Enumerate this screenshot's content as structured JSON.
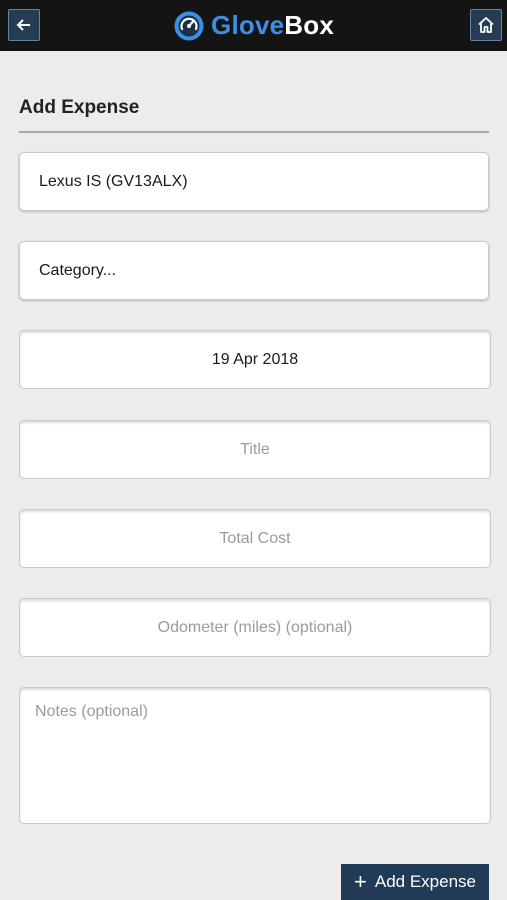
{
  "app": {
    "brand_part1": "Glove",
    "brand_part2": "Box"
  },
  "colors": {
    "topbar": "#141414",
    "brand_blue": "#3c8fe6",
    "button": "#213b57"
  },
  "icons": {
    "back": "arrow-left-icon",
    "home": "home-icon",
    "logo": "speedometer-logo-icon",
    "add": "plus-icon"
  },
  "form": {
    "heading": "Add Expense",
    "vehicle": "Lexus IS (GV13ALX)",
    "category": "Category...",
    "date": "19 Apr 2018",
    "title_placeholder": "Title",
    "cost_placeholder": "Total Cost",
    "odometer_placeholder": "Odometer (miles) (optional)",
    "notes_placeholder": "Notes (optional)",
    "submit_label": "Add Expense"
  }
}
